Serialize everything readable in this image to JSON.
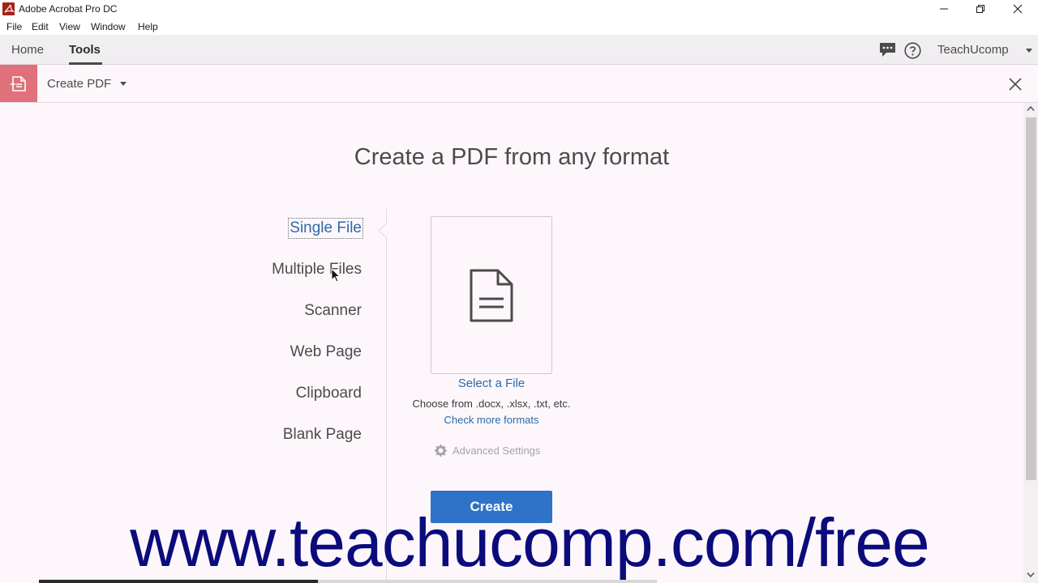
{
  "window": {
    "title": "Adobe Acrobat Pro DC"
  },
  "menu": [
    "File",
    "Edit",
    "View",
    "Window",
    "Help"
  ],
  "nav": {
    "tabs": [
      "Home",
      "Tools"
    ],
    "active_tab": "Tools",
    "user": "TeachUcomp"
  },
  "tool": {
    "title": "Create PDF"
  },
  "main": {
    "heading": "Create a PDF from any format",
    "sources": [
      "Single File",
      "Multiple Files",
      "Scanner",
      "Web Page",
      "Clipboard",
      "Blank Page"
    ],
    "selected_source": "Single File",
    "select_file": "Select a File",
    "choose_from": "Choose from .docx, .xlsx, .txt, etc.",
    "check_more": "Check more formats",
    "advanced_settings": "Advanced Settings",
    "create_button": "Create"
  },
  "watermark": "www.teachucomp.com/free",
  "colors": {
    "accent": "#2e73c8",
    "link": "#2d6aa7",
    "tool_icon_bg": "#e0707a",
    "watermark": "#0b0b7c"
  },
  "icons": [
    "acrobat-icon",
    "minimize-icon",
    "maximize-icon",
    "close-icon",
    "chat-icon",
    "help-icon",
    "create-pdf-icon",
    "document-icon",
    "gear-icon"
  ]
}
